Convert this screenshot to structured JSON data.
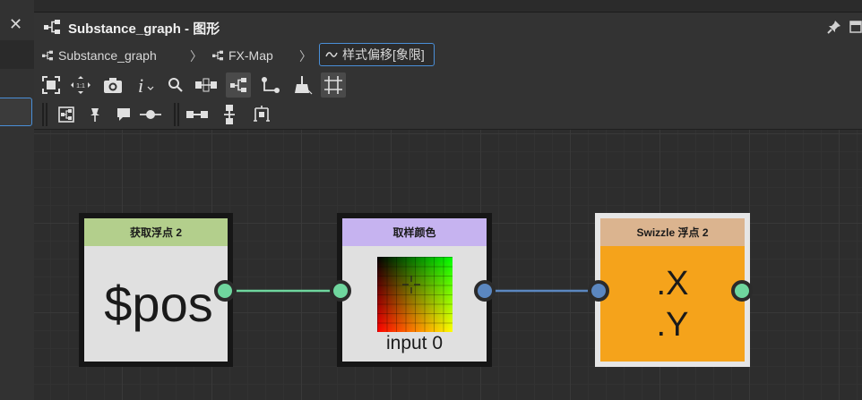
{
  "window": {
    "title": "Substance_graph - 图形"
  },
  "breadcrumbs": [
    {
      "label": "Substance_graph"
    },
    {
      "label": "FX-Map"
    },
    {
      "label": "样式偏移[象限]"
    }
  ],
  "nodes": {
    "get_float": {
      "header": "获取浮点 2",
      "body": "$pos",
      "header_color": "#b3cf8c"
    },
    "sample_color": {
      "header": "取样颜色",
      "body": "input 0",
      "header_color": "#c6b3f0"
    },
    "swizzle": {
      "header": "Swizzle 浮点 2",
      "line1": ".X",
      "line2": ".Y",
      "header_color": "#dbb48f",
      "body_color": "#f5a31b"
    }
  },
  "colors": {
    "accent": "#4a8fd8",
    "port_green": "#6fd69e",
    "port_blue": "#5b87c0",
    "wire_green": "#6fd69e",
    "wire_blue": "#5b87c0"
  }
}
